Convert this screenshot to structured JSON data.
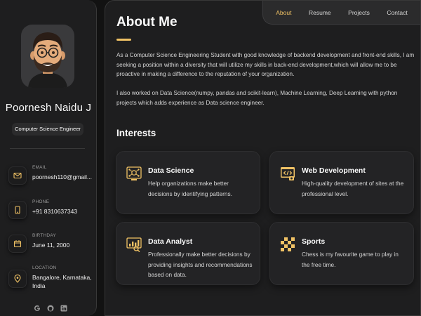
{
  "profile": {
    "name": "Poornesh Naidu J",
    "title": "Computer Science Engineer",
    "avatar_icon": "memoji-avatar"
  },
  "contacts": [
    {
      "icon": "mail-icon",
      "label": "EMAIL",
      "value": "poornesh110@gmail..."
    },
    {
      "icon": "phone-icon",
      "label": "PHONE",
      "value": "+91 8310637343"
    },
    {
      "icon": "calendar-icon",
      "label": "BIRTHDAY",
      "value": "June 11, 2000"
    },
    {
      "icon": "location-pin-icon",
      "label": "LOCATION",
      "value": "Bangalore, Karnataka, India"
    }
  ],
  "social": [
    "google-icon",
    "github-icon",
    "linkedin-icon"
  ],
  "nav": {
    "items": [
      {
        "label": "About",
        "active": true
      },
      {
        "label": "Resume",
        "active": false
      },
      {
        "label": "Projects",
        "active": false
      },
      {
        "label": "Contact",
        "active": false
      }
    ]
  },
  "about": {
    "title": "About Me",
    "paragraph1": "As a Computer Science Engineering Student with good knowledge of backend development and front-end skills, I am seeking a position within a diversity that will utilize my skills in back-end development,which will allow me to be proactive in making a difference to the reputation of your organization.",
    "paragraph2": "I also worked on Data Science(numpy, pandas and scikit-learn), Machine Learning, Deep Learning with python projects which adds experience as Data science engineer."
  },
  "interests": {
    "title": "Interests",
    "items": [
      {
        "icon": "data-science-icon",
        "title": "Data Science",
        "text": "Help organizations make better decisions by identifying patterns."
      },
      {
        "icon": "web-development-icon",
        "title": "Web Development",
        "text": "High-quality development of sites at the professional level."
      },
      {
        "icon": "data-analyst-icon",
        "title": "Data Analyst",
        "text": "Professionally make better decisions by providing insights and recommendations based on data."
      },
      {
        "icon": "sports-chess-icon",
        "title": "Sports",
        "text": "Chess is my favourite game to play in the free time."
      }
    ]
  },
  "colors": {
    "accent": "#f0c265",
    "background": "#121212",
    "panel": "#1e1e1f",
    "card": "#232325"
  }
}
